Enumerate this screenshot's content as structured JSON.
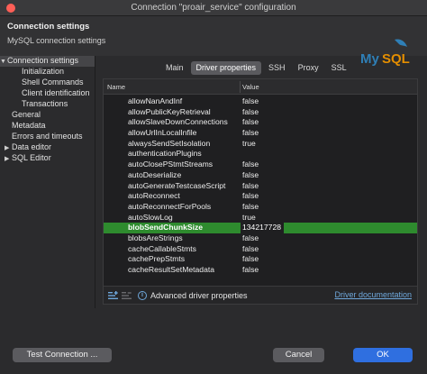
{
  "window": {
    "title": "Connection \"proair_service\" configuration"
  },
  "header": {
    "title": "Connection settings",
    "subtitle": "MySQL connection settings",
    "logo_text": "MySQL"
  },
  "sidebar": {
    "items": [
      {
        "label": "Connection settings",
        "expanded": true
      },
      {
        "label": "Initialization"
      },
      {
        "label": "Shell Commands"
      },
      {
        "label": "Client identification"
      },
      {
        "label": "Transactions"
      },
      {
        "label": "General"
      },
      {
        "label": "Metadata"
      },
      {
        "label": "Errors and timeouts"
      },
      {
        "label": "Data editor",
        "expanded": false
      },
      {
        "label": "SQL Editor",
        "expanded": false
      }
    ]
  },
  "tabs": [
    "Main",
    "Driver properties",
    "SSH",
    "Proxy",
    "SSL"
  ],
  "active_tab": "Driver properties",
  "table": {
    "columns": {
      "name": "Name",
      "value": "Value"
    },
    "rows": [
      {
        "name": "allowNanAndInf",
        "value": "false"
      },
      {
        "name": "allowPublicKeyRetrieval",
        "value": "false"
      },
      {
        "name": "allowSlaveDownConnections",
        "value": "false"
      },
      {
        "name": "allowUrlInLocalInfile",
        "value": "false"
      },
      {
        "name": "alwaysSendSetIsolation",
        "value": "true"
      },
      {
        "name": "authenticationPlugins",
        "value": ""
      },
      {
        "name": "autoClosePStmtStreams",
        "value": "false"
      },
      {
        "name": "autoDeserialize",
        "value": "false"
      },
      {
        "name": "autoGenerateTestcaseScript",
        "value": "false"
      },
      {
        "name": "autoReconnect",
        "value": "false"
      },
      {
        "name": "autoReconnectForPools",
        "value": "false"
      },
      {
        "name": "autoSlowLog",
        "value": "true"
      },
      {
        "name": "blobSendChunkSize",
        "value": "134217728",
        "selected": true
      },
      {
        "name": "blobsAreStrings",
        "value": "false"
      },
      {
        "name": "cacheCallableStmts",
        "value": "false"
      },
      {
        "name": "cachePrepStmts",
        "value": "false"
      },
      {
        "name": "cacheResultSetMetadata",
        "value": "false"
      }
    ]
  },
  "panel_footer": {
    "advanced_label": "Advanced driver properties",
    "doc_link": "Driver documentation"
  },
  "buttons": {
    "test": "Test Connection ...",
    "cancel": "Cancel",
    "ok": "OK"
  },
  "colors": {
    "accent": "#2f6fe0",
    "selected_row": "#2e8b2e",
    "link": "#6fa8dc",
    "mysql_blue": "#2f7fb6",
    "mysql_orange": "#e48e00"
  }
}
